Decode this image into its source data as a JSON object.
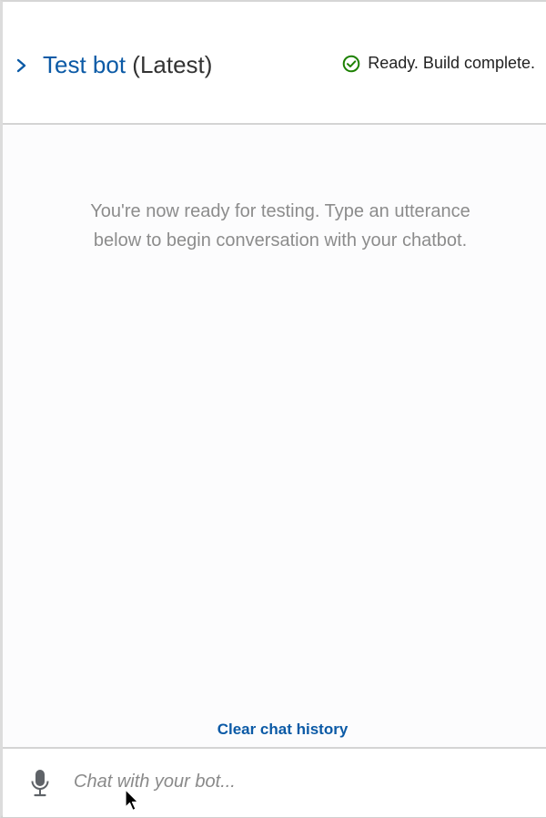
{
  "header": {
    "title_link": "Test bot",
    "title_suffix": "(Latest)",
    "status": "Ready. Build complete.",
    "status_color": "#1d8102",
    "icons": {
      "expand": "chevron-right-icon",
      "status": "check-circle-icon"
    }
  },
  "chat": {
    "welcome_message": "You're now ready for testing. Type an utterance below to begin conversation with your chatbot.",
    "clear_history_label": "Clear chat history"
  },
  "input": {
    "placeholder": "Chat with your bot...",
    "value": "",
    "mic_icon": "microphone-icon"
  },
  "colors": {
    "accent": "#0b5aa6",
    "muted_text": "#8c8c8c",
    "border": "#d4d4d4"
  }
}
